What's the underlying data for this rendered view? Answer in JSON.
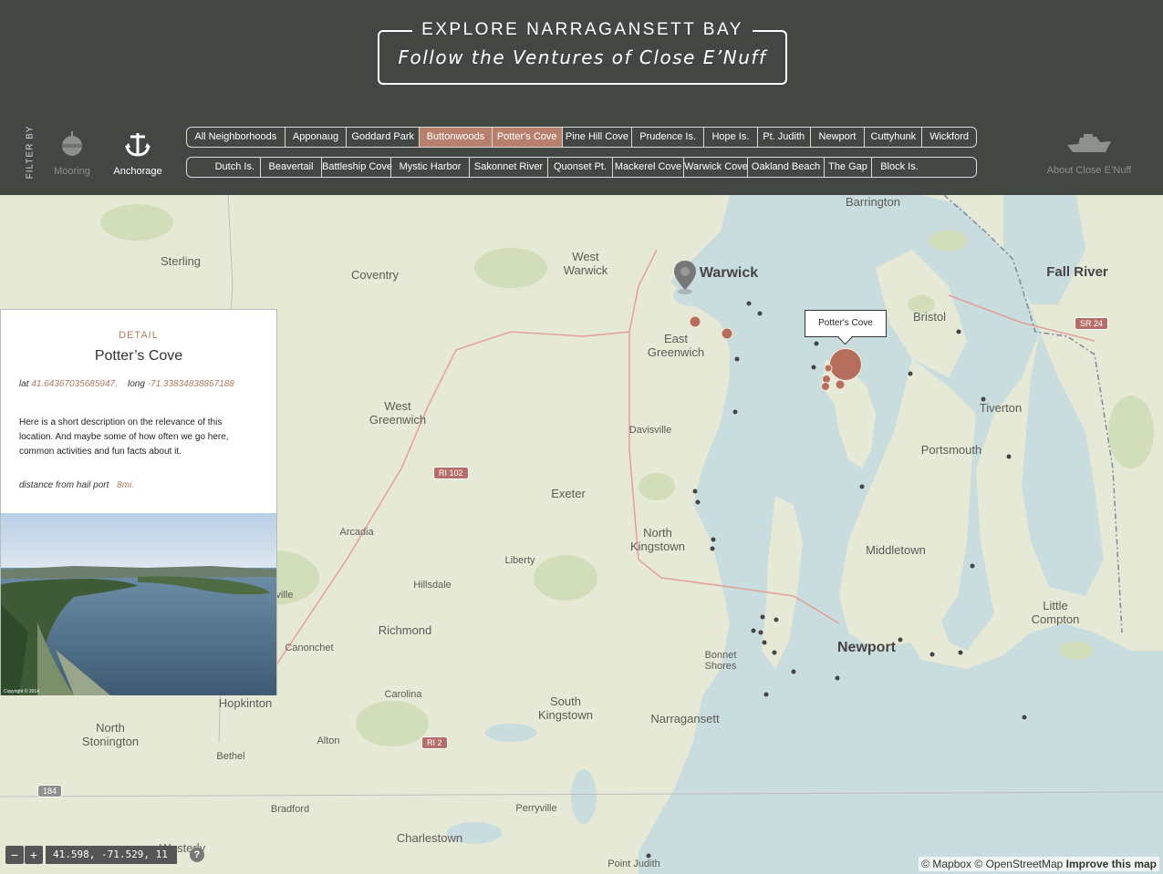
{
  "header": {
    "title": "EXPLORE NARRAGANSETT BAY",
    "subtitle": "Follow the Ventures of Close E’Nuff",
    "filter_label": "FILTER BY",
    "filters": [
      {
        "label": "Mooring",
        "icon": "buoy-icon"
      },
      {
        "label": "Anchorage",
        "icon": "anchor-icon"
      }
    ],
    "about_label": "About Close E’Nuff",
    "about_icon": "boat-icon"
  },
  "nav": {
    "row1": [
      {
        "label": "All Neighborhoods",
        "active": false
      },
      {
        "label": "Apponaug",
        "active": false
      },
      {
        "label": "Goddard Park",
        "active": false
      },
      {
        "label": "Buttonwoods",
        "active": true
      },
      {
        "label": "Potter's Cove",
        "active": true
      },
      {
        "label": "Pine Hill Cove",
        "active": false
      },
      {
        "label": "Prudence Is.",
        "active": false
      },
      {
        "label": "Hope Is.",
        "active": false
      },
      {
        "label": "Pt. Judith",
        "active": false
      },
      {
        "label": "Newport",
        "active": false
      },
      {
        "label": "Cuttyhunk",
        "active": false
      },
      {
        "label": "Wickford",
        "active": false
      }
    ],
    "row2": [
      {
        "label": "Dutch Is.",
        "active": false
      },
      {
        "label": "Beavertail",
        "active": false
      },
      {
        "label": "Battleship Cove",
        "active": false
      },
      {
        "label": "Mystic Harbor",
        "active": false
      },
      {
        "label": "Sakonnet River",
        "active": false
      },
      {
        "label": "Quonset Pt.",
        "active": false
      },
      {
        "label": "Mackerel Cove",
        "active": false
      },
      {
        "label": "Warwick Cove",
        "active": false
      },
      {
        "label": "Oakland Beach",
        "active": false
      },
      {
        "label": "The Gap",
        "active": false
      },
      {
        "label": "Block Is.",
        "active": false
      }
    ]
  },
  "detail": {
    "kicker": "DETAIL",
    "name": "Potter’s Cove",
    "lat_label": "lat",
    "lat": "41.64367035685947,",
    "long_label": "long",
    "long": "-71.33834838867188",
    "description": "Here is a short description on the relevance of this location. And maybe some of how often we go here, common activities and fun facts about it.",
    "distance_label": "distance from hail port",
    "distance": "8mi.",
    "photo_credit": "Copyright © 2014"
  },
  "map": {
    "tooltip": "Potter's Cove",
    "places": [
      "Barrington",
      "Sterling",
      "Coventry",
      "West Warwick",
      "Warwick",
      "Fall River",
      "Bristol",
      "East Greenwich",
      "West Greenwich",
      "Tiverton",
      "Davisville",
      "Portsmouth",
      "Exeter",
      "Arcadia",
      "North Kingstown",
      "Liberty",
      "Middletown",
      "Hillsdale",
      "Richmond",
      "Little Compton",
      "Newport",
      "Canonchet",
      "Bonnet Shores",
      "Carolina",
      "Hopkinton",
      "South Kingstown",
      "Narragansett",
      "North Stonington",
      "Alton",
      "Bethel",
      "Bradford",
      "Perryville",
      "Charlestown",
      "Westerly",
      "Point Judith",
      "ville"
    ],
    "shields": [
      "RI 102",
      "SR 24",
      "RI 2",
      "184"
    ],
    "zoom_in": "+",
    "zoom_out": "−",
    "coordinates": "41.598, -71.529, 11",
    "help": "?",
    "attribution_mapbox": "© Mapbox",
    "attribution_osm": "© OpenStreetMap",
    "attribution_improve": "Improve this map"
  },
  "colors": {
    "header_bg": "#434743",
    "accent": "#b7806c",
    "marker": "#b56e5c",
    "water": "#c9dcde",
    "land": "#e7e9d7"
  }
}
